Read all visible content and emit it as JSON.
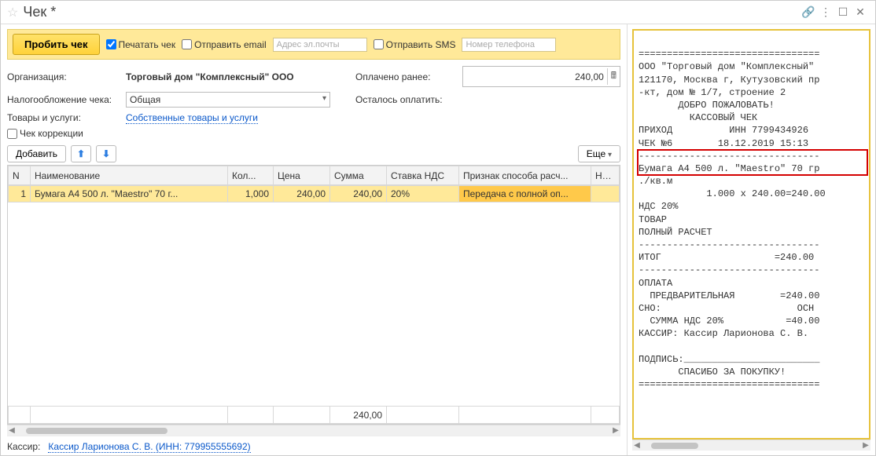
{
  "title": "Чек *",
  "window_icons": {
    "link": "🔗",
    "menu": "⋮",
    "max": "☐",
    "close": "✕"
  },
  "toolbar": {
    "submit_label": "Пробить чек",
    "print_label": "Печатать чек",
    "print_checked": true,
    "send_email_label": "Отправить email",
    "send_email_checked": false,
    "email_placeholder": "Адрес эл.почты",
    "send_sms_label": "Отправить SMS",
    "send_sms_checked": false,
    "phone_placeholder": "Номер телефона"
  },
  "fields": {
    "org_lbl": "Организация:",
    "org_val": "Торговый дом \"Комплексный\" ООО",
    "paid_lbl": "Оплачено ранее:",
    "paid_val": "240,00",
    "tax_lbl": "Налогообложение чека:",
    "tax_val": "Общая",
    "remain_lbl": "Осталось оплатить:",
    "goods_lbl": "Товары и услуги:",
    "goods_link": "Собственные товары и услуги",
    "correction_lbl": "Чек коррекции"
  },
  "table_toolbar": {
    "add_label": "Добавить",
    "more_label": "Еще"
  },
  "columns": {
    "n": "N",
    "name": "Наименование",
    "qty": "Кол...",
    "price": "Цена",
    "sum": "Сумма",
    "vat": "Ставка НДС",
    "payment_sign": "Признак способа расч...",
    "nom": "Но..."
  },
  "rows": [
    {
      "n": "1",
      "name": "Бумага А4 500 л. \"Maestro\" 70 г...",
      "qty": "1,000",
      "price": "240,00",
      "sum": "240,00",
      "vat": "20%",
      "payment_sign": "Передача с полной оп...",
      "nom": ""
    }
  ],
  "totals": {
    "sum": "240,00"
  },
  "footer": {
    "cashier_lbl": "Кассир:",
    "cashier_link": "Кассир Ларионова С. В. (ИНН: 779955555692)"
  },
  "receipt": {
    "text": "================================\nООО \"Торговый дом \"Комплексный\"\n121170, Москва г, Кутузовский пр\n-кт, дом № 1/7, строение 2\n       ДОБРО ПОЖАЛОВАТЬ!\n         КАССОВЫЙ ЧЕК\nПРИХОД          ИНН 7799434926\nЧЕК №6        18.12.2019 15:13\n--------------------------------\nБумага А4 500 л. \"Maestro\" 70 гр\n./кв.м\n            1.000 x 240.00=240.00\nНДС 20%\nТОВАР\nПОЛНЫЙ РАСЧЕТ\n--------------------------------\nИТОГ                    =240.00\n--------------------------------\nОПЛАТА\n  ПРЕДВАРИТЕЛЬНАЯ        =240.00\nСНО:                        ОСН\n  СУММА НДС 20%           =40.00\nКАССИР: Кассир Ларионова С. В.\n\nПОДПИСЬ:________________________\n       СПАСИБО ЗА ПОКУПКУ!\n================================"
  }
}
